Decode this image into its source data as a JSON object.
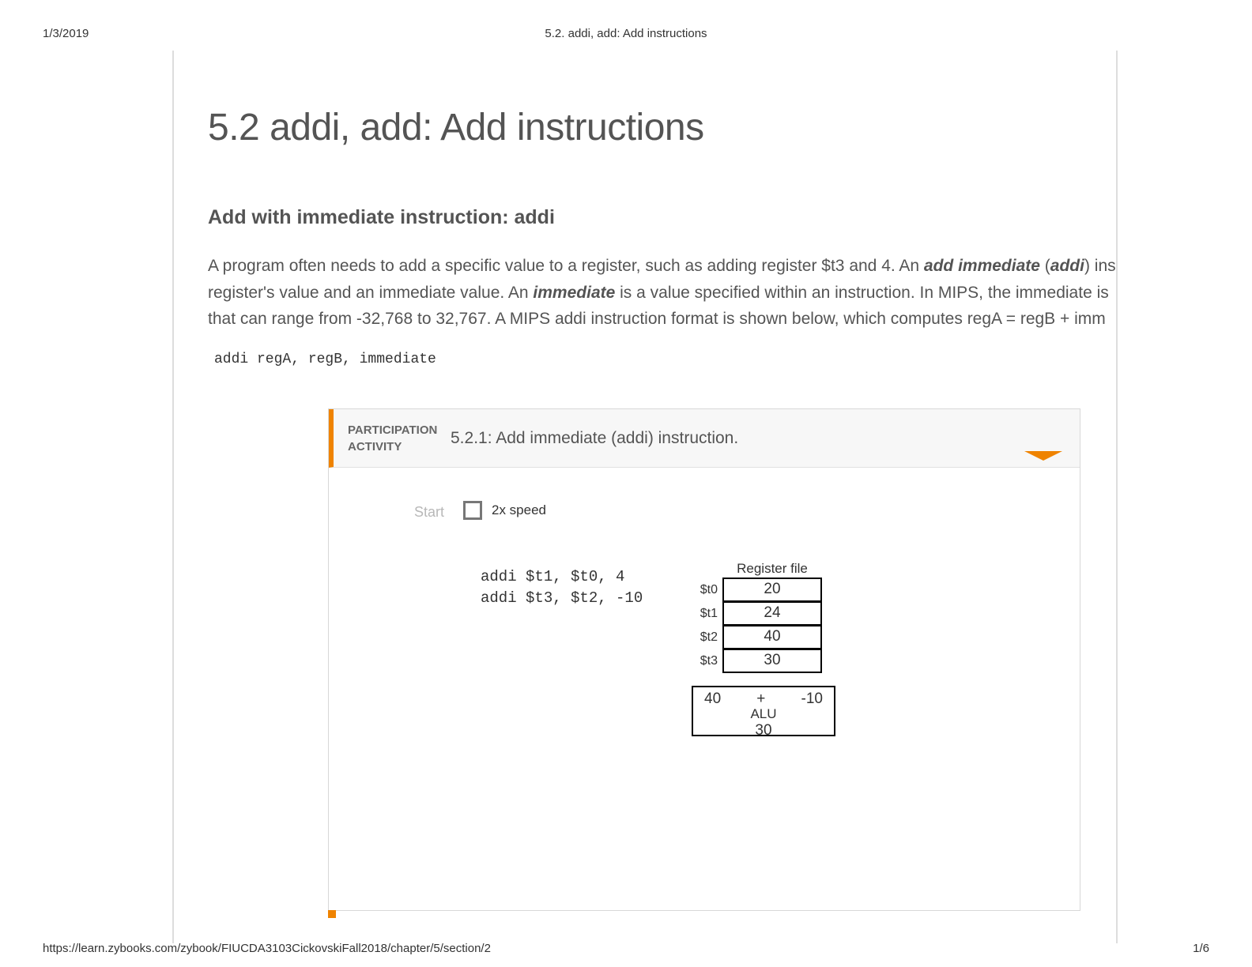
{
  "print": {
    "date": "1/3/2019",
    "header_title": "5.2. addi, add: Add instructions",
    "footer_url": "https://learn.zybooks.com/zybook/FIUCDA3103CickovskiFall2018/chapter/5/section/2",
    "footer_page": "1/6"
  },
  "page": {
    "title": "5.2 addi, add: Add instructions",
    "subheading": "Add with immediate instruction: addi",
    "para_pre1": "A program often needs to add a specific value to a register, such as adding register $t3 and 4. An ",
    "term_add_immediate": "add immediate",
    "para_pre2": " (",
    "term_addi": "addi",
    "para_post2": ") inst",
    "para_line2a": "register's value and an immediate value. An ",
    "term_immediate": "immediate",
    "para_line2b": " is a value specified within an instruction. In MIPS, the immediate is ",
    "para_line3": "that can range from -32,768 to 32,767. A MIPS addi instruction format is shown below, which computes regA = regB + imm",
    "code": "addi regA, regB, immediate"
  },
  "activity": {
    "label_line1": "PARTICIPATION",
    "label_line2": "ACTIVITY",
    "title": "5.2.1: Add immediate (addi) instruction.",
    "start": "Start",
    "speed_label": "2x speed",
    "asm": "addi $t1, $t0, 4\naddi $t3, $t2, -10",
    "regfile_title": "Register file",
    "registers": [
      {
        "name": "$t0",
        "value": "20"
      },
      {
        "name": "$t1",
        "value": "24"
      },
      {
        "name": "$t2",
        "value": "40"
      },
      {
        "name": "$t3",
        "value": "30"
      }
    ],
    "alu": {
      "left": "40",
      "op": "+",
      "right": "-10",
      "label": "ALU",
      "result": "30"
    }
  }
}
